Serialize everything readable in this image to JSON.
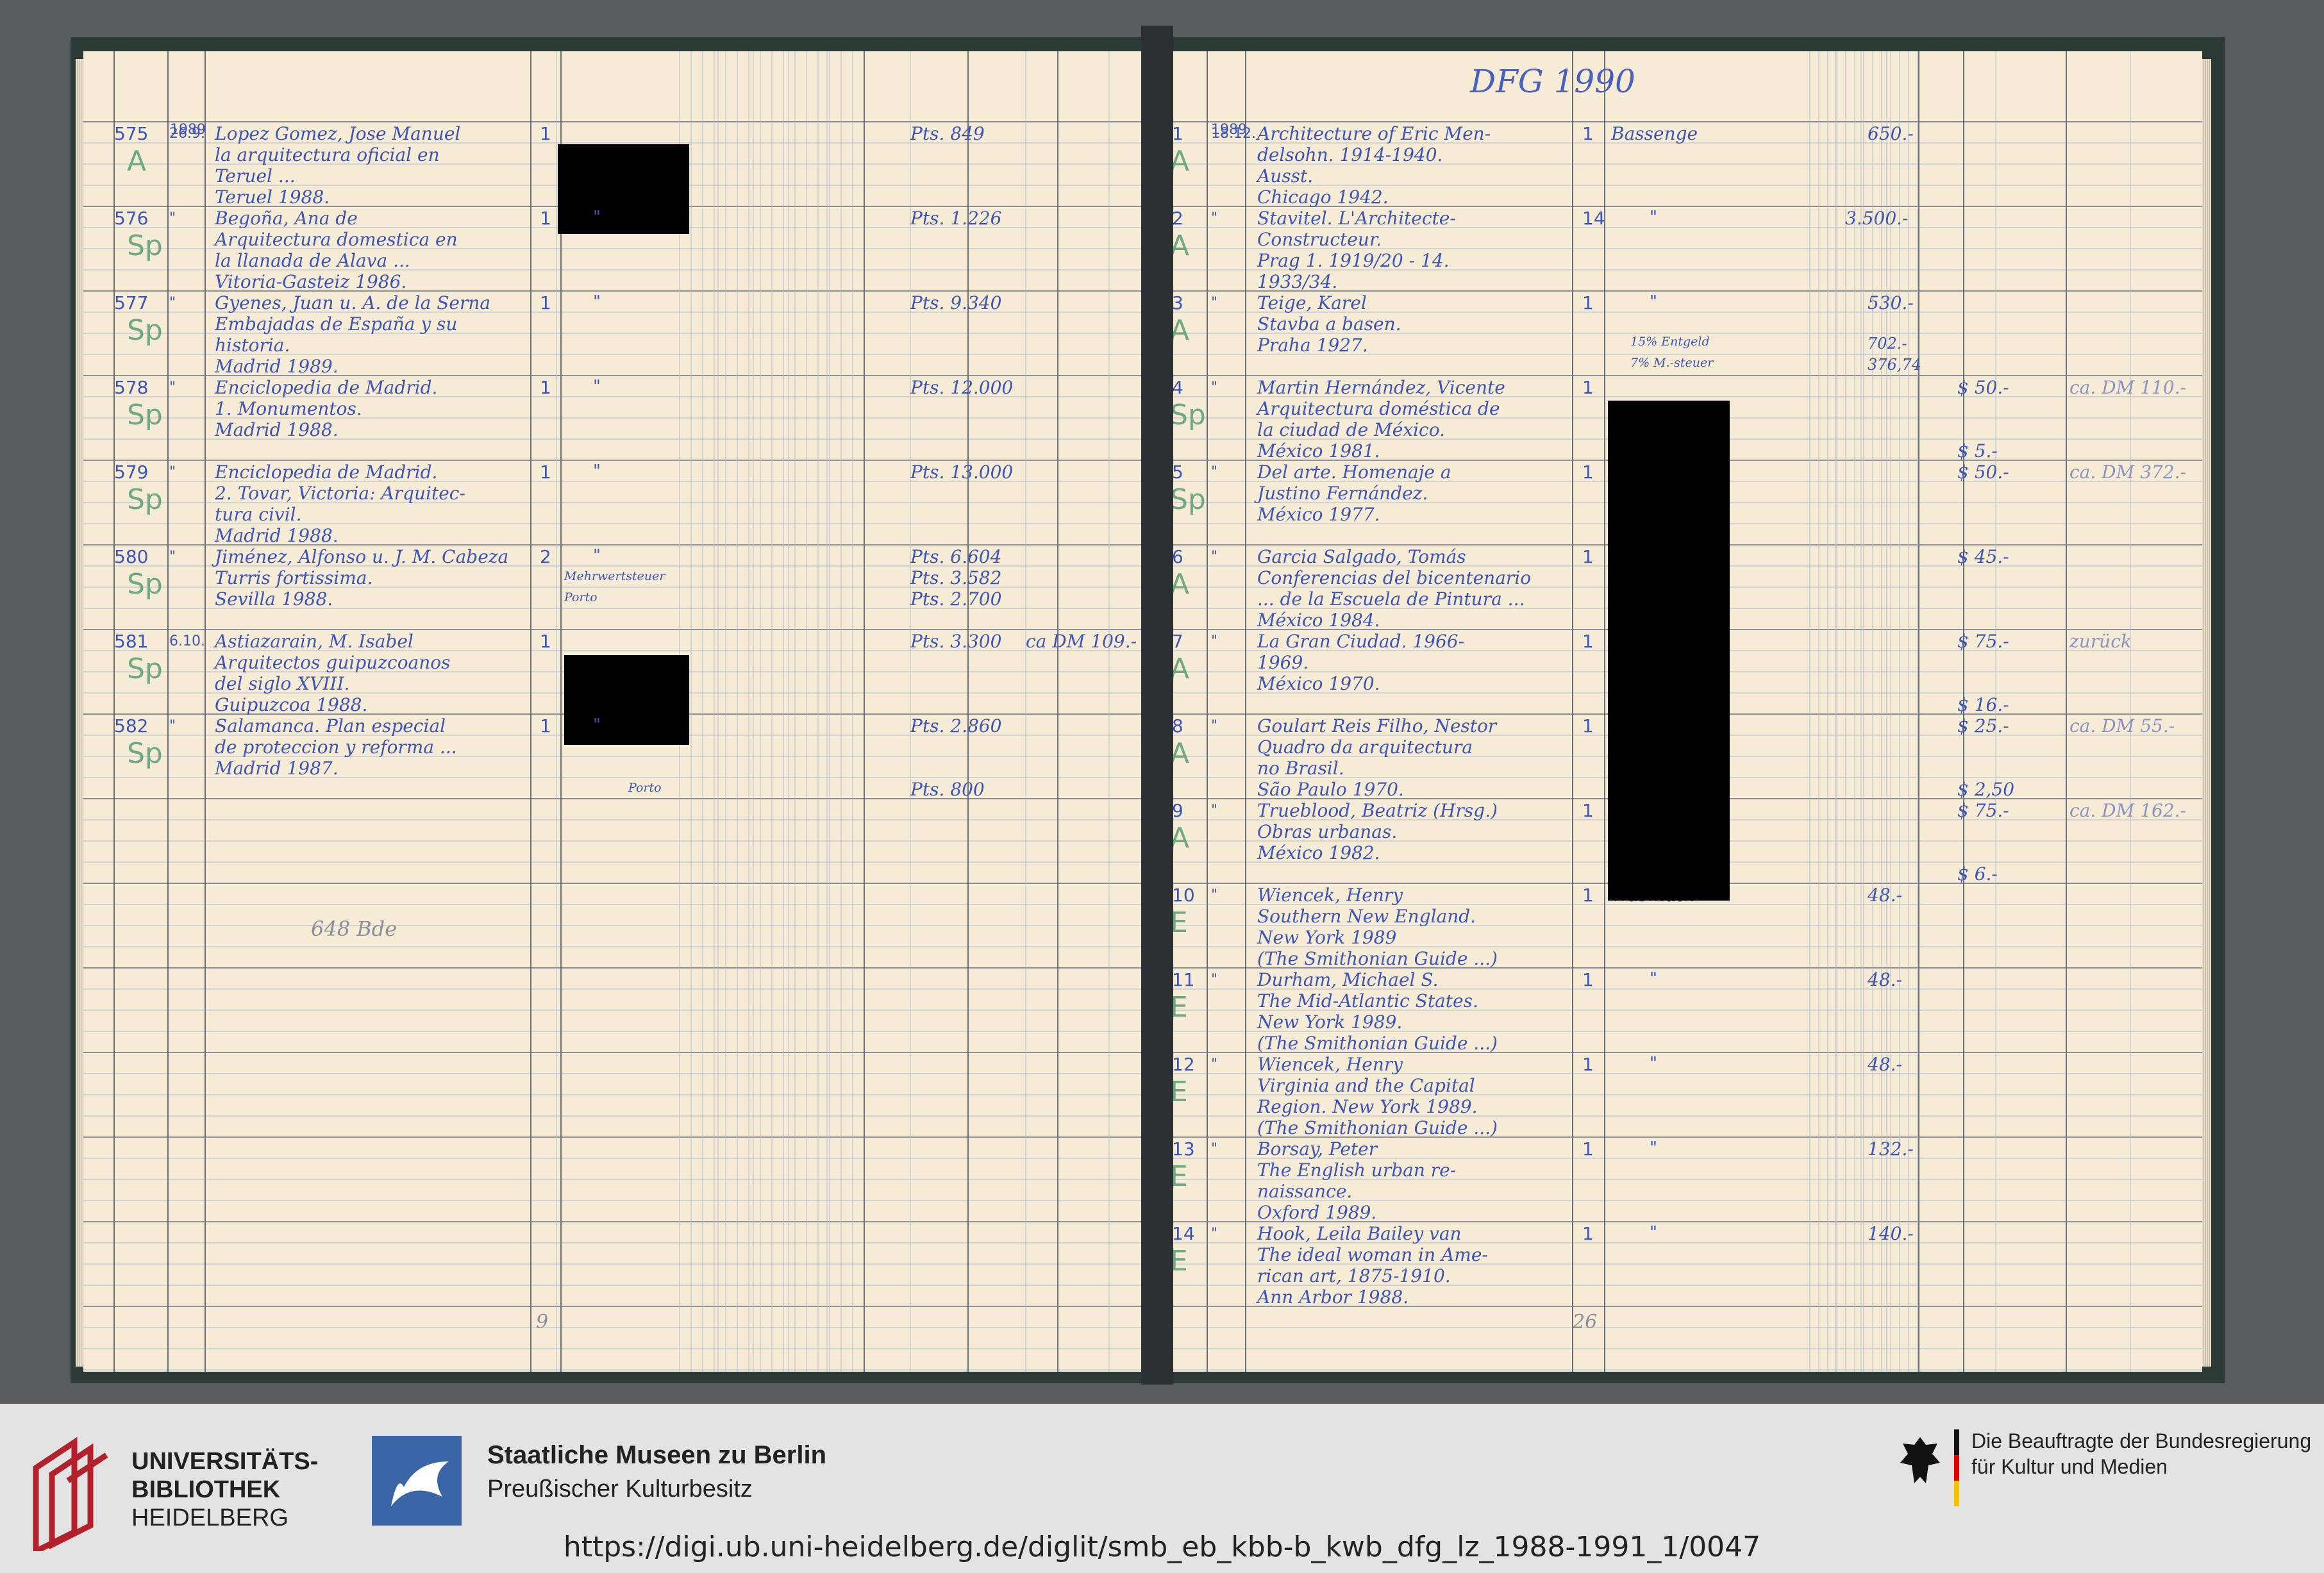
{
  "left": {
    "year": "1989",
    "entries": [
      {
        "no": "575",
        "date": "26.9.",
        "sig": "A",
        "lines": [
          "Lopez Gomez, Jose Manuel",
          "la arquitectura oficial en",
          "Teruel ...",
          "Teruel 1988."
        ],
        "qty": "1",
        "price": [
          "Pts.   849"
        ]
      },
      {
        "no": "576",
        "date": "\"",
        "sig": "Sp",
        "lines": [
          "Begoña, Ana de",
          "Arquitectura domestica en",
          "la llanada de Alava ...",
          "Vitoria-Gasteiz 1986."
        ],
        "qty": "1",
        "price": [
          "Pts. 1.226"
        ]
      },
      {
        "no": "577",
        "date": "\"",
        "sig": "Sp",
        "lines": [
          "Gyenes, Juan u. A. de la Serna",
          "Embajadas de España y su",
          "historia.",
          "Madrid 1989."
        ],
        "qty": "1",
        "price": [
          "Pts. 9.340"
        ]
      },
      {
        "no": "578",
        "date": "\"",
        "sig": "Sp",
        "lines": [
          "Enciclopedia de Madrid.",
          "1. Monumentos.",
          "Madrid 1988."
        ],
        "qty": "1",
        "price": [
          "Pts. 12.000"
        ]
      },
      {
        "no": "579",
        "date": "\"",
        "sig": "Sp",
        "lines": [
          "Enciclopedia de Madrid.",
          "2. Tovar, Victoria: Arquitec-",
          "tura civil.",
          "Madrid 1988."
        ],
        "qty": "1",
        "price": [
          "Pts. 13.000"
        ]
      },
      {
        "no": "580",
        "date": "\"",
        "sig": "Sp",
        "lines": [
          "Jiménez, Alfonso u. J. M. Cabeza",
          "Turris fortissima.",
          "Sevilla 1988."
        ],
        "qty": "2",
        "price": [
          "Pts. 6.604",
          "Pts. 3.582",
          "Pts. 2.700"
        ],
        "notes": [
          "Mehrwertsteuer",
          "Porto"
        ]
      },
      {
        "no": "581",
        "date": "6.10.",
        "sig": "Sp",
        "lines": [
          "Astiazarain, M. Isabel",
          "Arquitectos guipuzcoanos",
          "del siglo XVIII.",
          "Guipuzcoa 1988."
        ],
        "qty": "1",
        "price": [
          "Pts. 3.300"
        ],
        "dm": "ca DM 109.-"
      },
      {
        "no": "582",
        "date": "\"",
        "sig": "Sp",
        "lines": [
          "Salamanca. Plan especial",
          "de proteccion y reforma ...",
          "Madrid 1987."
        ],
        "qty": "1",
        "price": [
          "Pts. 2.860",
          "Pts.    800"
        ],
        "notes": [
          "Porto"
        ]
      }
    ],
    "total_note": "648 Bde",
    "page_no": "9"
  },
  "right": {
    "header": "DFG   1990",
    "year": "1989",
    "entries": [
      {
        "no": "1",
        "date": "18.12.",
        "sig": "A",
        "lines": [
          "Architecture of Eric Men-",
          "delsohn. 1914-1940.",
          "Ausst.",
          "Chicago 1942."
        ],
        "qty": "1",
        "dealer": "Bassenge",
        "amount": "650.-"
      },
      {
        "no": "2",
        "date": "\"",
        "sig": "A",
        "lines": [
          "Stavitel. L'Architecte-",
          "Constructeur.",
          "Prag 1. 1919/20 - 14.",
          "1933/34."
        ],
        "qty": "14",
        "amount": "3.500.-"
      },
      {
        "no": "3",
        "date": "\"",
        "sig": "A",
        "lines": [
          "Teige, Karel",
          "Stavba a basen.",
          "Praha 1927."
        ],
        "qty": "1",
        "amount": "530.-",
        "extras": [
          "15% Entgeld",
          "7% M.-steuer"
        ],
        "extra_amounts": [
          "702.-",
          "376,74"
        ]
      },
      {
        "no": "4",
        "date": "\"",
        "sig": "Sp",
        "lines": [
          "Martin Hernández, Vicente",
          "Arquitectura doméstica de",
          "la ciudad de México.",
          "México 1981."
        ],
        "qty": "1",
        "usd": [
          "$    50.-",
          "$      5.-"
        ],
        "dm": "ca. DM 110.-"
      },
      {
        "no": "5",
        "date": "\"",
        "sig": "Sp",
        "lines": [
          "Del arte. Homenaje a",
          "Justino Fernández.",
          "México 1977."
        ],
        "qty": "1",
        "usd": [
          "$    50.-"
        ],
        "dm": "ca. DM 372.-"
      },
      {
        "no": "6",
        "date": "\"",
        "sig": "A",
        "lines": [
          "Garcia Salgado, Tomás",
          "Conferencias del bicentenario",
          "... de la Escuela de Pintura ...",
          "México 1984."
        ],
        "qty": "1",
        "usd": [
          "$    45.-"
        ]
      },
      {
        "no": "7",
        "date": "\"",
        "sig": "A",
        "lines": [
          "La Gran Ciudad. 1966-",
          "1969.",
          "México 1970."
        ],
        "qty": "1",
        "usd": [
          "$    75.-",
          "$    16.-"
        ],
        "dm": "zurück"
      },
      {
        "no": "8",
        "date": "\"",
        "sig": "A",
        "lines": [
          "Goulart Reis Filho, Nestor",
          "Quadro da arquitectura",
          "no Brasil.",
          "São Paulo 1970."
        ],
        "qty": "1",
        "usd": [
          "$    25.-",
          "$     2,50"
        ],
        "dm": "ca. DM 55.-"
      },
      {
        "no": "9",
        "date": "\"",
        "sig": "A",
        "lines": [
          "Trueblood, Beatriz (Hrsg.)",
          "Obras urbanas.",
          "México 1982."
        ],
        "qty": "1",
        "usd": [
          "$    75.-",
          "$      6.-"
        ],
        "dm": "ca. DM 162.-"
      },
      {
        "no": "10",
        "date": "\"",
        "sig": "E",
        "lines": [
          "Wiencek, Henry",
          "Southern New England.",
          "New York 1989",
          "(The Smithonian Guide ...)"
        ],
        "qty": "1",
        "dealer": "Wasmuth",
        "amount": "48.-"
      },
      {
        "no": "11",
        "date": "\"",
        "sig": "E",
        "lines": [
          "Durham, Michael S.",
          "The Mid-Atlantic States.",
          "New York 1989.",
          "(The Smithonian Guide ...)"
        ],
        "qty": "1",
        "amount": "48.-"
      },
      {
        "no": "12",
        "date": "\"",
        "sig": "E",
        "lines": [
          "Wiencek, Henry",
          "Virginia and the Capital",
          "Region.  New York 1989.",
          "(The Smithonian Guide ...)"
        ],
        "qty": "1",
        "amount": "48.-"
      },
      {
        "no": "13",
        "date": "\"",
        "sig": "E",
        "lines": [
          "Borsay, Peter",
          "The English urban re-",
          "naissance.",
          "Oxford 1989."
        ],
        "qty": "1",
        "amount": "132.-"
      },
      {
        "no": "14",
        "date": "\"",
        "sig": "E",
        "lines": [
          "Hook, Leila Bailey van",
          "The ideal woman in Ame-",
          "rican art, 1875-1910.",
          "Ann Arbor 1988."
        ],
        "qty": "1",
        "amount": "140.-"
      }
    ],
    "page_no": "26"
  },
  "footer": {
    "ub_line1": "UNIVERSITÄTS-",
    "ub_line2": "BIBLIOTHEK",
    "ub_line3": "HEIDELBERG",
    "smb_line1": "Staatliche Museen zu Berlin",
    "smb_line2": "Preußischer Kulturbesitz",
    "bkm_line1": "Die Beauftragte der Bundesregierung",
    "bkm_line2": "für Kultur und Medien",
    "url": "https://digi.ub.uni-heidelberg.de/diglit/smb_eb_kbb-b_kwb_dfg_lz_1988-1991_1/0047"
  },
  "colors": {
    "ink": "#3e55b8",
    "signature_ink": "#6fa983",
    "paper": "#f6ecd6",
    "ruling": "#bcc6d4",
    "column_rule": "#8a8f99",
    "cover": "#2b3a36"
  }
}
